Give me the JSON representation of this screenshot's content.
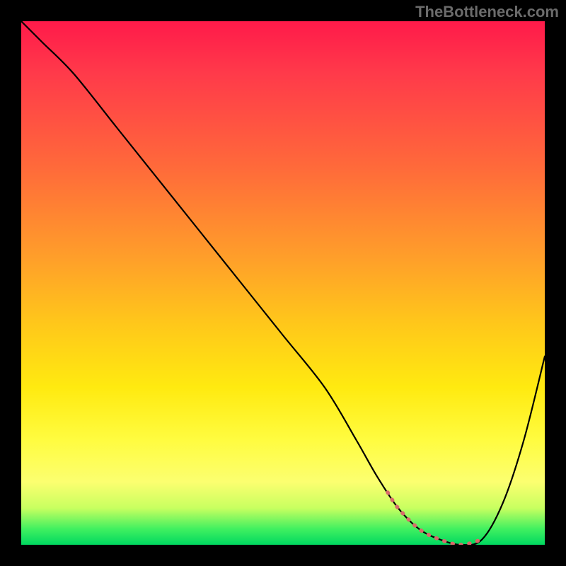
{
  "watermark": "TheBottleneck.com",
  "colors": {
    "background": "#000000",
    "curve": "#000000",
    "dots": "#d86a6a",
    "watermark_text": "#6b6b6b"
  },
  "chart_data": {
    "type": "line",
    "title": "",
    "xlabel": "",
    "ylabel": "",
    "xlim": [
      0,
      100
    ],
    "ylim": [
      0,
      100
    ],
    "grid": false,
    "legend": false,
    "series": [
      {
        "name": "bottleneck-curve",
        "x": [
          0,
          4,
          10,
          18,
          26,
          34,
          42,
          50,
          58,
          64,
          68,
          72,
          76,
          80,
          84,
          88,
          92,
          96,
          100
        ],
        "values": [
          100,
          96,
          90,
          80,
          70,
          60,
          50,
          40,
          30,
          20,
          13,
          7,
          3,
          1,
          0,
          1,
          8,
          20,
          36
        ]
      }
    ],
    "optimal_range_x": [
      70,
      88
    ],
    "annotations": []
  }
}
